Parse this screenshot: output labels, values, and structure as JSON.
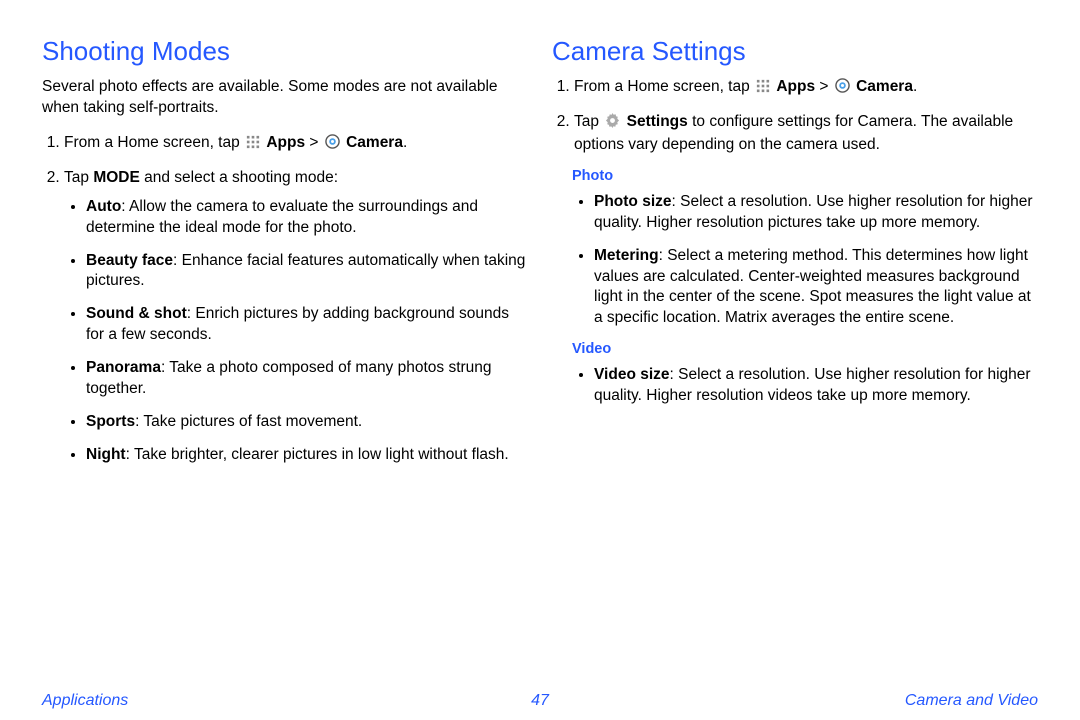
{
  "left": {
    "heading": "Shooting Modes",
    "intro": "Several photo effects are available. Some modes are not available when taking self-portraits.",
    "step1_prefix": "From a Home screen, tap ",
    "step1_apps": "Apps",
    "step1_sep": " > ",
    "step1_camera": "Camera",
    "step1_end": ".",
    "step2_prefix": "Tap ",
    "step2_mode": "MODE",
    "step2_suffix": " and select a shooting mode:",
    "modes": [
      {
        "name": "Auto",
        "desc": ": Allow the camera to evaluate the surroundings and determine the ideal mode for the photo."
      },
      {
        "name": "Beauty face",
        "desc": ": Enhance facial features automatically when taking pictures."
      },
      {
        "name": "Sound & shot",
        "desc": ": Enrich pictures by adding background sounds for a few seconds."
      },
      {
        "name": "Panorama",
        "desc": ": Take a photo composed of many photos strung together."
      },
      {
        "name": "Sports",
        "desc": ": Take pictures of fast movement."
      },
      {
        "name": "Night",
        "desc": ": Take brighter, clearer pictures in low light without flash."
      }
    ]
  },
  "right": {
    "heading": "Camera Settings",
    "step1_prefix": "From a Home screen, tap ",
    "step1_apps": "Apps",
    "step1_sep": " > ",
    "step1_camera": "Camera",
    "step1_end": ".",
    "step2_prefix": "Tap ",
    "step2_settings": "Settings",
    "step2_suffix": " to configure settings for Camera. The available options vary depending on the camera used.",
    "photo_heading": "Photo",
    "photo_items": [
      {
        "name": "Photo size",
        "desc": ": Select a resolution. Use higher resolution for higher quality. Higher resolution pictures take up more memory."
      },
      {
        "name": "Metering",
        "desc": ": Select a metering method. This determines how light values are calculated. Center-weighted measures background light in the center of the scene. Spot measures the light value at a specific location. Matrix averages the entire scene."
      }
    ],
    "video_heading": "Video",
    "video_items": [
      {
        "name": "Video size",
        "desc": ": Select a resolution. Use higher resolution for higher quality. Higher resolution videos take up more memory."
      }
    ]
  },
  "footer": {
    "left": "Applications",
    "center": "47",
    "right": "Camera and Video"
  }
}
